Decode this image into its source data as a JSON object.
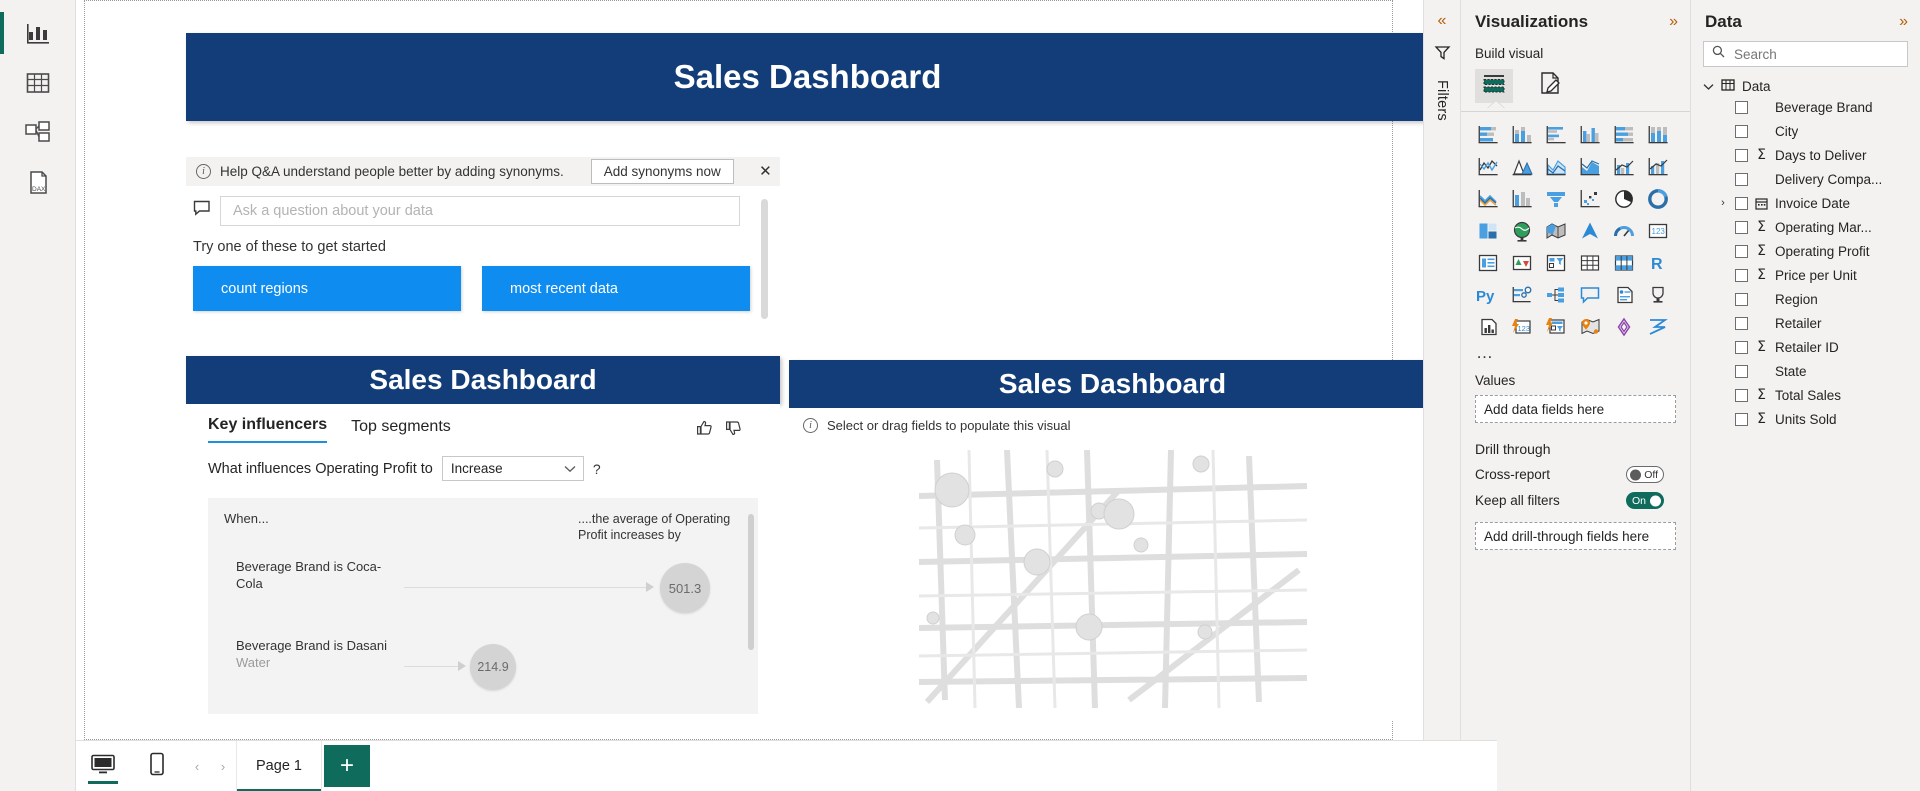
{
  "rail": {
    "items": [
      {
        "name": "report-view",
        "icon": "bar-chart-icon",
        "selected": true
      },
      {
        "name": "table-view",
        "icon": "table-icon",
        "selected": false
      },
      {
        "name": "model-view",
        "icon": "model-icon",
        "selected": false
      },
      {
        "name": "dax-query-view",
        "icon": "dax-icon",
        "selected": false
      }
    ]
  },
  "canvas": {
    "banners": {
      "main": "Sales Dashboard",
      "key_influencers": "Sales Dashboard",
      "map": "Sales Dashboard"
    },
    "qna": {
      "banner_text": "Help Q&A understand people better by adding synonyms.",
      "add_synonyms_label": "Add synonyms now",
      "close_label": "✕",
      "input_placeholder": "Ask a question about your data",
      "input_value": "",
      "suggestions_title": "Try one of these to get started",
      "chips": [
        "count regions",
        "most recent data"
      ]
    },
    "key_influencers": {
      "tabs": [
        {
          "label": "Key influencers",
          "active": true
        },
        {
          "label": "Top segments",
          "active": false
        }
      ],
      "question_prefix": "What influences Operating Profit to",
      "direction_value": "Increase",
      "help_label": "?",
      "column_left": "When...",
      "column_right": "....the average of Operating Profit increases by",
      "rows": [
        {
          "label": "Beverage Brand is Coca-Cola",
          "sub": "",
          "value": "501.3"
        },
        {
          "label": "Beverage Brand is Dasani",
          "sub": "Water",
          "value": "214.9"
        }
      ]
    },
    "map": {
      "hint": "Select or drag fields to populate this visual"
    }
  },
  "pane_strip": {
    "collapse_label": "«",
    "filters_label": "Filters"
  },
  "visualizations": {
    "title": "Visualizations",
    "expand_label": "»",
    "build_label": "Build visual",
    "build_tabs": [
      {
        "name": "fields-tab",
        "selected": true
      },
      {
        "name": "format-tab",
        "selected": false
      }
    ],
    "more_label": "…",
    "gallery": [
      "stacked-bar-chart-icon",
      "stacked-column-chart-icon",
      "clustered-bar-chart-icon",
      "clustered-column-chart-icon",
      "100-stacked-bar-chart-icon",
      "100-stacked-column-chart-icon",
      "line-chart-icon",
      "area-chart-icon",
      "stacked-area-chart-icon",
      "line-stacked-column-icon",
      "line-clustered-column-icon",
      "ribbon-chart-icon",
      "waterfall-chart-icon",
      "funnel-chart-icon",
      "funnel-icon",
      "scatter-chart-icon",
      "pie-chart-icon",
      "donut-chart-icon",
      "treemap-icon",
      "map-icon",
      "filled-map-icon",
      "azure-map-icon",
      "gauge-icon",
      "card-icon",
      "multi-row-card-icon",
      "kpi-icon",
      "slicer-icon",
      "table-icon",
      "matrix-icon",
      "r-script-visual-icon",
      "python-visual-icon",
      "key-influencers-icon",
      "decomposition-tree-icon",
      "qna-icon",
      "smart-narrative-icon",
      "metrics-icon",
      "paginated-report-icon",
      "power-apps-icon",
      "power-automate-icon",
      "arcgis-map-icon",
      "visio-icon",
      "zebra-bi-icon"
    ],
    "values_label": "Values",
    "values_placeholder": "Add data fields here",
    "drill_through_label": "Drill through",
    "cross_report_label": "Cross-report",
    "cross_report_state": "Off",
    "keep_all_filters_label": "Keep all filters",
    "keep_all_filters_state": "On",
    "drill_through_placeholder": "Add drill-through fields here"
  },
  "data_pane": {
    "title": "Data",
    "expand_label": "»",
    "search_placeholder": "Search",
    "search_value": "",
    "table_label": "Data",
    "fields": [
      {
        "name": "Beverage Brand",
        "measure": false,
        "expandable": false
      },
      {
        "name": "City",
        "measure": false,
        "expandable": false
      },
      {
        "name": "Days to Deliver",
        "measure": true,
        "expandable": false
      },
      {
        "name": "Delivery Compa...",
        "measure": false,
        "expandable": false
      },
      {
        "name": "Invoice Date",
        "measure": false,
        "expandable": true,
        "date": true
      },
      {
        "name": "Operating Mar...",
        "measure": true,
        "expandable": false
      },
      {
        "name": "Operating Profit",
        "measure": true,
        "expandable": false
      },
      {
        "name": "Price per Unit",
        "measure": true,
        "expandable": false
      },
      {
        "name": "Region",
        "measure": false,
        "expandable": false
      },
      {
        "name": "Retailer",
        "measure": false,
        "expandable": false
      },
      {
        "name": "Retailer ID",
        "measure": true,
        "expandable": false
      },
      {
        "name": "State",
        "measure": false,
        "expandable": false
      },
      {
        "name": "Total Sales",
        "measure": true,
        "expandable": false
      },
      {
        "name": "Units Sold",
        "measure": true,
        "expandable": false
      }
    ]
  },
  "bottom_bar": {
    "desktop_view_icon": "desktop-icon",
    "mobile_view_icon": "mobile-icon",
    "prev_label": "‹",
    "next_label": "›",
    "pages": [
      {
        "label": "Page 1",
        "active": true
      }
    ],
    "add_page_label": "+"
  },
  "colors": {
    "brand_banner": "#123d78",
    "accent_green": "#0f6b5c",
    "chip_blue": "#0f8cf0",
    "tab_underline": "#1e90d8"
  }
}
